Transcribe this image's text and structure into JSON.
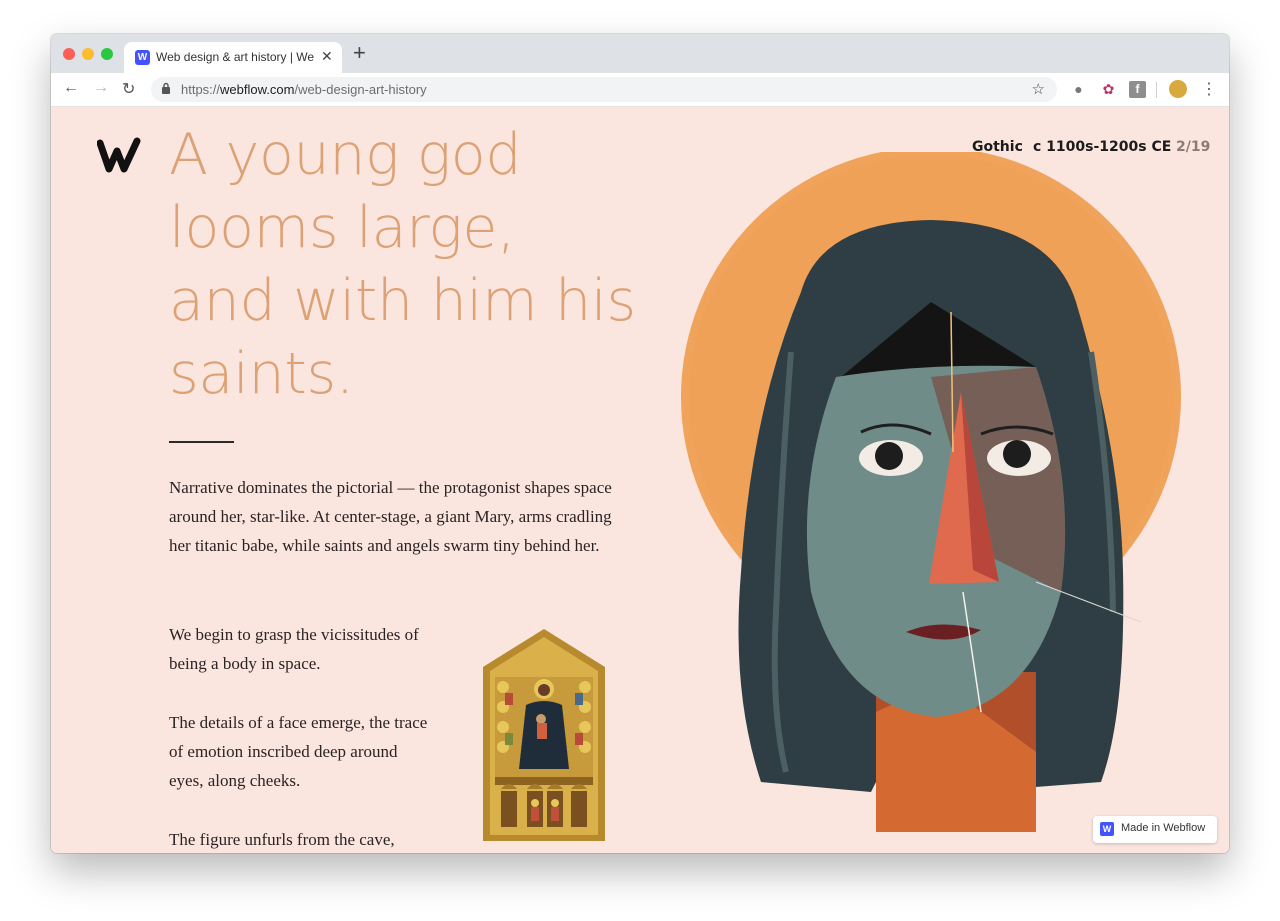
{
  "browser": {
    "tab_title": "Web design & art history | Webflow",
    "tab_favicon": "W",
    "tab_close": "✕",
    "new_tab": "+",
    "url_scheme": "https://",
    "url_host": "webflow.com",
    "url_path": "/web-design-art-history",
    "icons": [
      "back-icon",
      "forward-icon",
      "reload-icon",
      "lock-icon",
      "star-icon",
      "globe-icon",
      "extension-icon",
      "facebook-icon",
      "profile-avatar",
      "menu-icon"
    ]
  },
  "page": {
    "headline": "A young god looms large, and with him his saints.",
    "period": "Gothic",
    "date_range": "c 1100s-1200s CE",
    "slide_counter": "2/19",
    "paragraphs": [
      "Narrative dominates the pictorial — the protagonist shapes space around her, star-like. At center-stage, a giant Mary, arms cradling her titanic babe, while saints and angels swarm tiny behind her.",
      "We begin to grasp the vicissitudes of being a body in space.",
      "The details of a face emerge, the trace of emotion inscribed deep around eyes, along cheeks.",
      "The figure unfurls from the cave,"
    ],
    "badge_label": "Made in Webflow",
    "colors": {
      "background": "#fbe5df",
      "headline": "#dca174",
      "halo": "#f0a35a",
      "hair": "#2e3e44",
      "face": "#6f8c88",
      "nose": "#e06a4e"
    }
  }
}
